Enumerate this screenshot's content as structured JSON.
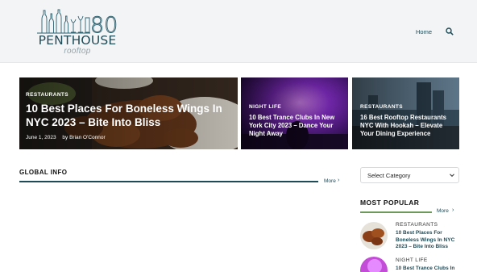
{
  "brand": {
    "logo_number": "808",
    "name": "PENTHOUSE",
    "sub": "rooftop",
    "accent_color": "#1f4b57",
    "green_accent": "#6c9a5b"
  },
  "nav": {
    "home_label": "Home",
    "search_icon": "search-icon"
  },
  "hero": [
    {
      "category": "RESTAURANTS",
      "title": "10 Best Places For Boneless Wings In NYC 2023 – Bite Into Bliss",
      "date": "June 1, 2023",
      "author": "by Brian O'Connor"
    },
    {
      "category": "NIGHT LIFE",
      "title": "10 Best Trance Clubs In New York City 2023 – Dance Your Night Away"
    },
    {
      "category": "RESTAURANTS",
      "title": "16 Best Rooftop Restaurants NYC With Hookah – Elevate Your Dining Experience"
    }
  ],
  "global": {
    "title": "GLOBAL INFO",
    "more_label": "More",
    "more_icon": "chevron-right-icon"
  },
  "sidebar": {
    "select_value": "Select Category",
    "select_icon": "chevron-down-icon",
    "popular_title": "MOST POPULAR",
    "more_label": "More",
    "items": [
      {
        "category": "RESTAURANTS",
        "title": "10 Best Places For Boneless Wings In NYC 2023 – Bite Into Bliss"
      },
      {
        "category": "NIGHT LIFE",
        "title": "10 Best Trance Clubs In"
      }
    ]
  }
}
